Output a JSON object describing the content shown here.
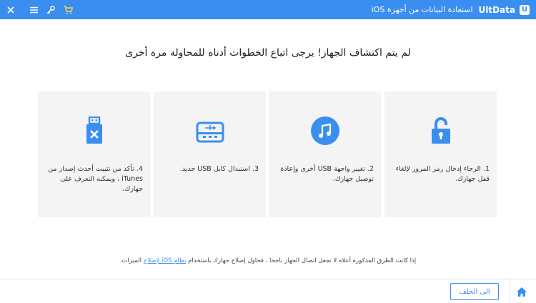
{
  "titlebar": {
    "app_name": "UltData",
    "app_title": "استعادة البيانات من أجهزة iOS",
    "logo_letter": "U",
    "icons": [
      "close-icon",
      "menu-icon",
      "key-icon",
      "cart-icon"
    ]
  },
  "main": {
    "heading": "لم يتم اكتشاف الجهاز! يرجى اتباع الخطوات أدناه للمحاولة مرة أخرى",
    "cards": [
      {
        "icon": "unlock-icon",
        "text": "1. الرجاء إدخال رمز المرور لإلغاء قفل جهازك."
      },
      {
        "icon": "music-icon",
        "text": "2. تغيير واجهة USB أخرى وإعادة توصيل جهازك."
      },
      {
        "icon": "usb-hub-icon",
        "text": "3. استبدال كابل USB جديد."
      },
      {
        "icon": "usb-error-icon",
        "text": "4. تأكد من تثبيت أحدث إصدار من iTunes ، ويمكنه التعرف على جهازك."
      }
    ],
    "footer_text_before": "إذا كانت الطرق المذكورة أعلاه لا تجعل اتصال الجهاز ناجحا ، فحاول إصلاح جهازك باستخدام",
    "footer_link": "نظام iOS لإصلاح",
    "footer_text_after": "الميزات."
  },
  "bottombar": {
    "back_label": "الى الخلف",
    "home_icon": "home-icon"
  },
  "colors": {
    "accent": "#3a8ef0",
    "card_bg": "#f4f4f4"
  }
}
